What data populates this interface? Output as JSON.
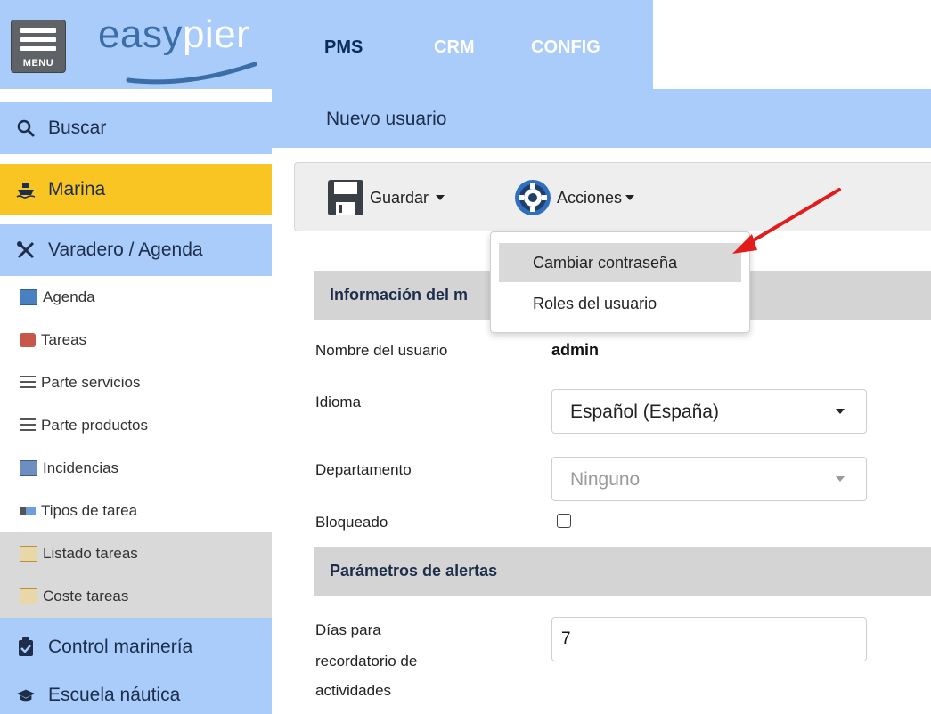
{
  "topbar": {
    "menu_label": "MENU",
    "logo_part1": "easy",
    "logo_part2": "pier",
    "nav": [
      "PMS",
      "CRM",
      "CONFIG"
    ]
  },
  "sidebar": {
    "search": "Buscar",
    "marina": "Marina",
    "varadero": "Varadero / Agenda",
    "sub_items": [
      "Agenda",
      "Tareas",
      "Parte servicios",
      "Parte productos",
      "Incidencias",
      "Tipos de tarea",
      "Listado tareas",
      "Coste tareas"
    ],
    "control": "Control marinería",
    "escuela": "Escuela náutica"
  },
  "header": {
    "title": "Nuevo usuario"
  },
  "toolbar": {
    "save_label": "Guardar",
    "actions_label": "Acciones"
  },
  "dropdown": {
    "items": [
      "Cambiar contraseña",
      "Roles del usuario"
    ]
  },
  "form": {
    "section_info": "Información del m",
    "username_label": "Nombre del usuario",
    "username_value": "admin",
    "language_label": "Idioma",
    "language_value": "Español (España)",
    "department_label": "Departamento",
    "department_value": "Ninguno",
    "blocked_label": "Bloqueado",
    "section_alerts": "Parámetros de alertas",
    "days_label_1": "Días para",
    "days_label_2": "recordatorio de",
    "days_label_3": "actividades",
    "days_value": "7"
  },
  "colors": {
    "topbar_blue": "#a9ccfb",
    "marina_yellow": "#f8c522",
    "sidebar_blue": "#a9ccfb",
    "sidebar_gray": "#d9d9d9",
    "arrow_red": "#e31b1b"
  }
}
